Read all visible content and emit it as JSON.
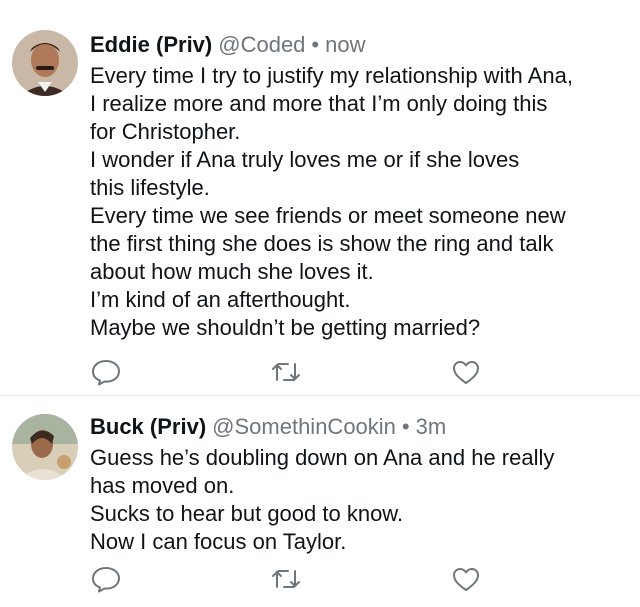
{
  "tweets": [
    {
      "display_name": "Eddie (Priv)",
      "handle": "@Coded",
      "separator": "•",
      "time": "now",
      "lines": [
        "Every time I try to justify my relationship with Ana,",
        "I realize more and more that I’m only doing this",
        "for Christopher.",
        "I wonder if Ana truly loves me or if she loves",
        "this lifestyle.",
        "Every time we see friends or meet someone new",
        "the first thing she does is show the ring and talk",
        "about how much she loves it.",
        "I’m kind of an afterthought.",
        "Maybe we shouldn’t be getting married?"
      ],
      "avatar_icon": "profile-photo"
    },
    {
      "display_name": "Buck (Priv)",
      "handle": "@SomethinCookin",
      "separator": "•",
      "time": "3m",
      "lines": [
        "Guess he’s doubling down on Ana and he really",
        "has moved on.",
        "Sucks to hear but good to know.",
        "Now I can focus on Taylor."
      ],
      "avatar_icon": "profile-photo"
    }
  ],
  "actions": [
    "reply-icon",
    "retweet-icon",
    "like-icon"
  ],
  "colors": {
    "text": "#0f1419",
    "muted": "#6e767d",
    "divider": "#e6e8eb",
    "icon": "#6e767d"
  }
}
